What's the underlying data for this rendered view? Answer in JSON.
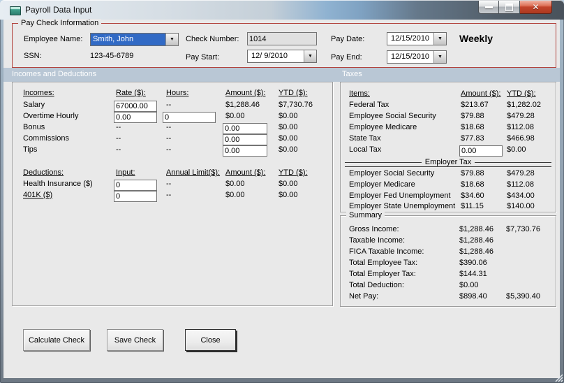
{
  "window": {
    "title": "Payroll Data Input",
    "close_glyph": "✕"
  },
  "paycheck": {
    "group_label": "Pay Check Information",
    "employee_name_label": "Employee Name:",
    "employee_name_value": "Smith, John",
    "ssn_label": "SSN:",
    "ssn_value": "123-45-6789",
    "check_number_label": "Check Number:",
    "check_number_value": "1014",
    "pay_start_label": "Pay Start:",
    "pay_start_value": "12/ 9/2010",
    "pay_date_label": "Pay Date:",
    "pay_date_value": "12/15/2010",
    "pay_end_label": "Pay End:",
    "pay_end_value": "12/15/2010",
    "frequency": "Weekly",
    "dropdown_arrow": "▼"
  },
  "sections": {
    "incomes_deductions": "Incomes and Deductions",
    "taxes": "Taxes"
  },
  "incomes": {
    "headers": {
      "item": "Incomes:",
      "rate": "Rate ($):",
      "hours": "Hours:",
      "amount": "Amount ($):",
      "ytd": "YTD ($):"
    },
    "rows": [
      {
        "label": "Salary",
        "rate": "67000.00",
        "hours": "--",
        "amount": "$1,288.46",
        "ytd": "$7,730.76"
      },
      {
        "label": "Overtime Hourly",
        "rate": "0.00",
        "hours": "0",
        "amount": "$0.00",
        "ytd": "$0.00"
      },
      {
        "label": "Bonus",
        "rate": "--",
        "hours": "--",
        "amount": "0.00",
        "ytd": "$0.00"
      },
      {
        "label": "Commissions",
        "rate": "--",
        "hours": "--",
        "amount": "0.00",
        "ytd": "$0.00"
      },
      {
        "label": "Tips",
        "rate": "--",
        "hours": "--",
        "amount": "0.00",
        "ytd": "$0.00"
      }
    ]
  },
  "deductions": {
    "headers": {
      "item": "Deductions:",
      "input": "Input:",
      "annual_limit": "Annual Limit($):",
      "amount": "Amount ($):",
      "ytd": "YTD ($):"
    },
    "rows": [
      {
        "label": "Health Insurance  ($)",
        "input": "0",
        "annual_limit": "--",
        "amount": "$0.00",
        "ytd": "$0.00"
      },
      {
        "label": "401K  ($)",
        "input": "0",
        "annual_limit": "--",
        "amount": "$0.00",
        "ytd": "$0.00"
      }
    ]
  },
  "taxes": {
    "headers": {
      "item": "Items:",
      "amount": "Amount ($):",
      "ytd": "YTD ($):"
    },
    "employee_rows": [
      {
        "label": "Federal Tax",
        "amount": "$213.67",
        "ytd": "$1,282.02"
      },
      {
        "label": "Employee Social Security",
        "amount": "$79.88",
        "ytd": "$479.28"
      },
      {
        "label": "Employee Medicare",
        "amount": "$18.68",
        "ytd": "$112.08"
      },
      {
        "label": "State Tax",
        "amount": "$77.83",
        "ytd": "$466.98"
      },
      {
        "label": "Local Tax",
        "amount": "0.00",
        "ytd": "$0.00"
      }
    ],
    "employer_divider": "Employer Tax",
    "employer_rows": [
      {
        "label": "Employer Social Security",
        "amount": "$79.88",
        "ytd": "$479.28"
      },
      {
        "label": "Employer Medicare",
        "amount": "$18.68",
        "ytd": "$112.08"
      },
      {
        "label": "Employer Fed Unemployment",
        "amount": "$34.60",
        "ytd": "$434.00"
      },
      {
        "label": "Employer State Unemployment",
        "amount": "$11.15",
        "ytd": "$140.00"
      }
    ]
  },
  "summary": {
    "group_label": "Summary",
    "rows": [
      {
        "label": "Gross Income:",
        "value": "$1,288.46",
        "ytd": "$7,730.76"
      },
      {
        "label": "Taxable Income:",
        "value": "$1,288.46",
        "ytd": ""
      },
      {
        "label": "FICA Taxable Income:",
        "value": "$1,288.46",
        "ytd": ""
      },
      {
        "label": "Total Employee Tax:",
        "value": "$390.06",
        "ytd": ""
      },
      {
        "label": "Total Employer Tax:",
        "value": "$144.31",
        "ytd": ""
      },
      {
        "label": "Total Deduction:",
        "value": "$0.00",
        "ytd": ""
      },
      {
        "label": "Net Pay:",
        "value": "$898.40",
        "ytd": "$5,390.40"
      }
    ]
  },
  "buttons": {
    "calculate": "Calculate Check",
    "save": "Save Check",
    "close": "Close"
  },
  "colors": {
    "accent_red": "#b2423c",
    "band_blue": "#b9c7d5",
    "selection_blue": "#316ac5",
    "close_button_red": "#c2452c",
    "client_gray": "#e9e9e9"
  }
}
